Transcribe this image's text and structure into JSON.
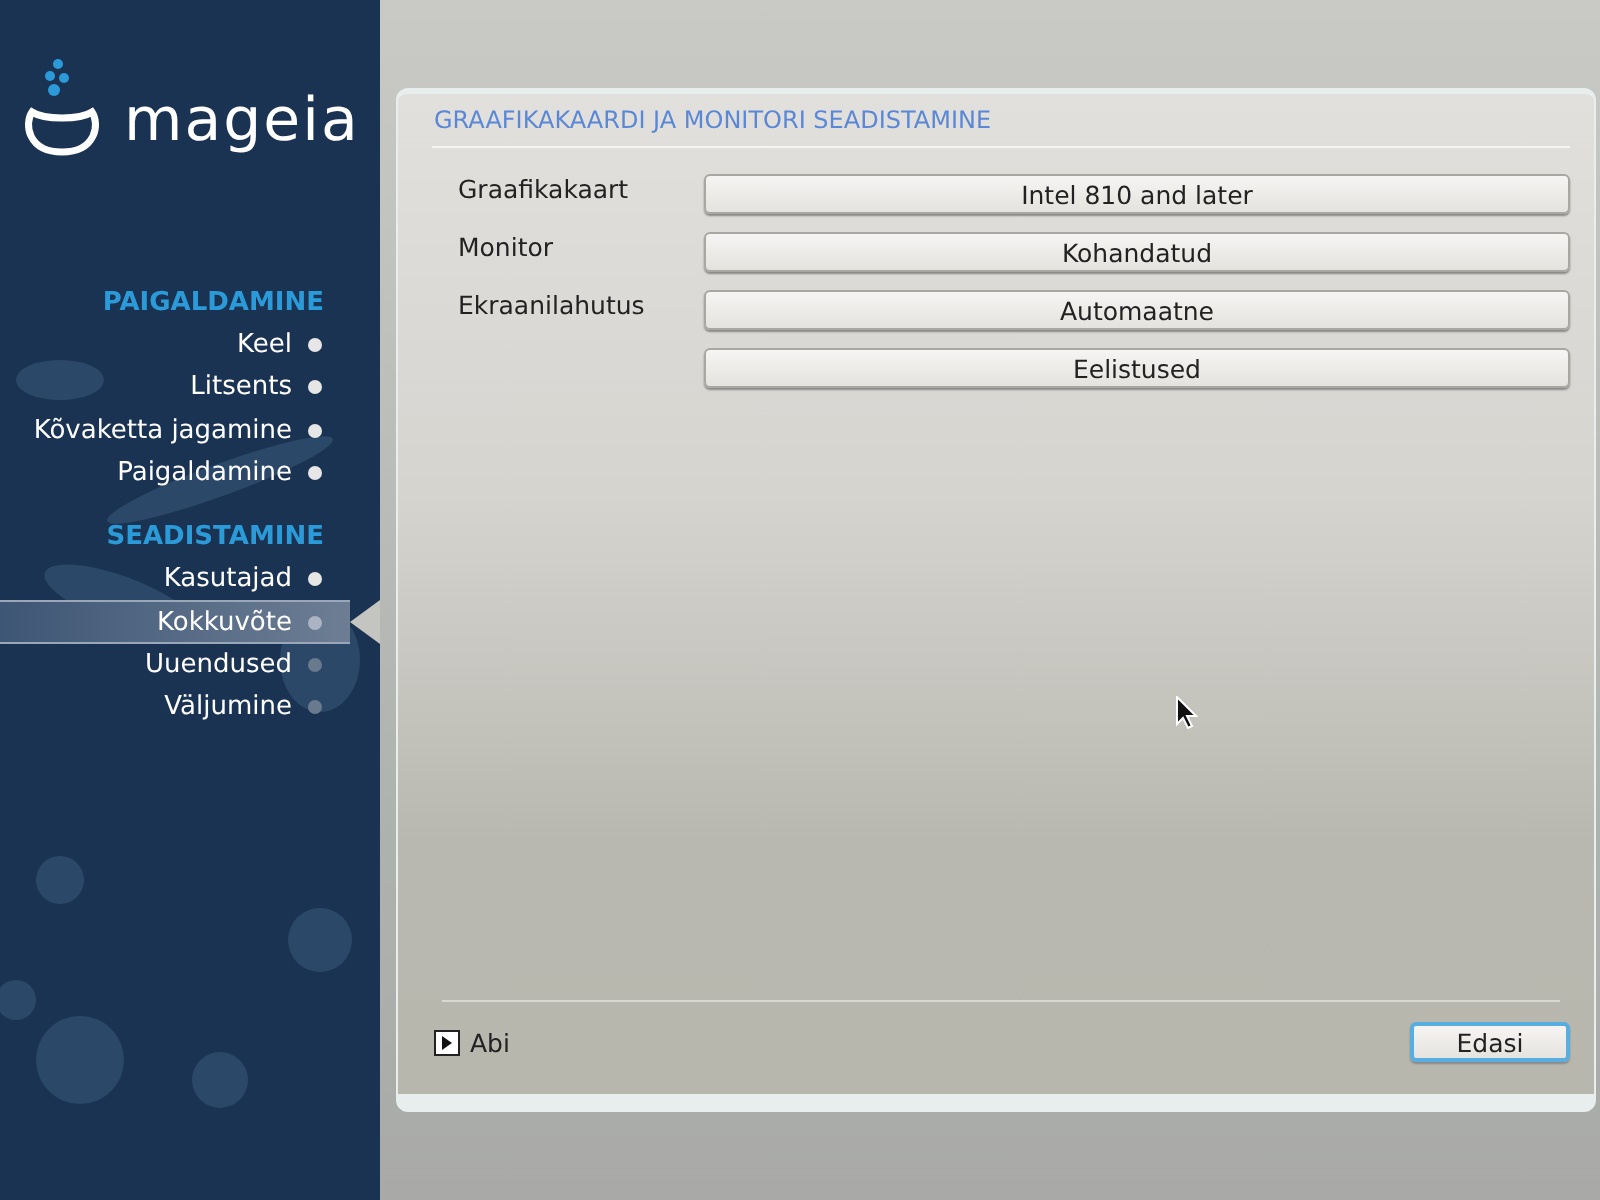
{
  "sidebar": {
    "logo": "mageia",
    "sections": [
      {
        "title": "PAIGALDAMINE",
        "items": [
          {
            "label": "Keel",
            "done": true,
            "selected": false
          },
          {
            "label": "Litsents",
            "done": true,
            "selected": false
          },
          {
            "label": "Kõvaketta jagamine",
            "done": true,
            "selected": false
          },
          {
            "label": "Paigaldamine",
            "done": true,
            "selected": false
          }
        ]
      },
      {
        "title": "SEADISTAMINE",
        "items": [
          {
            "label": "Kasutajad",
            "done": true,
            "selected": false
          },
          {
            "label": "Kokkuvõte",
            "done": false,
            "selected": true
          },
          {
            "label": "Uuendused",
            "done": false,
            "selected": false
          },
          {
            "label": "Väljumine",
            "done": false,
            "selected": false
          }
        ]
      }
    ]
  },
  "panel": {
    "title": "GRAAFIKAKAARDI JA MONITORI SEADISTAMINE",
    "rows": [
      {
        "label": "Graafikakaart",
        "value": "Intel 810 and later"
      },
      {
        "label": "Monitor",
        "value": "Kohandatud"
      },
      {
        "label": "Ekraanilahutus",
        "value": "Automaatne"
      },
      {
        "value": "Eelistused"
      }
    ],
    "help": {
      "label": "Abi",
      "expanded": false
    },
    "next_button": {
      "label": "Edasi",
      "focused": true
    }
  }
}
